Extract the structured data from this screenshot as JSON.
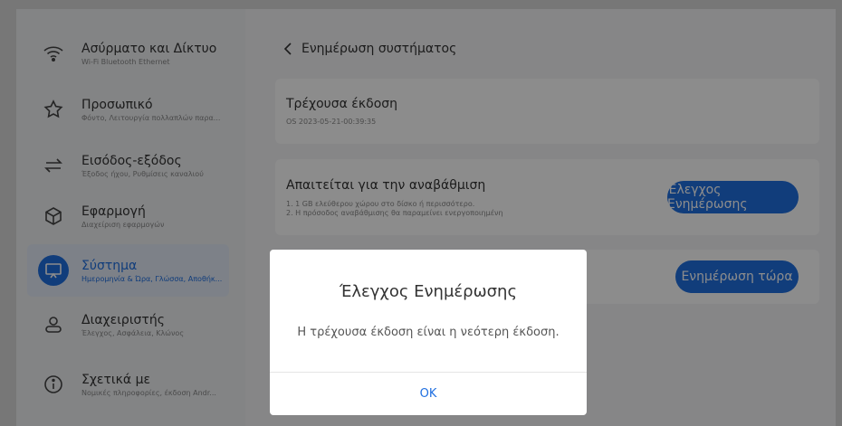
{
  "sidebar": {
    "items": [
      {
        "title": "Ασύρματο και Δίκτυο",
        "sub": "Wi-Fi Bluetooth Ethernet",
        "icon": "wifi-icon"
      },
      {
        "title": "Προσωπικό",
        "sub": "Φόντο, Λειτουργία πολλαπλών παρα...",
        "icon": "star-icon"
      },
      {
        "title": "Εισόδος-εξόδος",
        "sub": "Έξοδος ήχου, Ρυθμίσεις καναλιού",
        "icon": "arrows-swap-icon"
      },
      {
        "title": "Εφαρμογή",
        "sub": "Διαχείριση εφαρμογών",
        "icon": "cube-icon"
      },
      {
        "title": "Σύστημα",
        "sub": "Ημερομηνία & Ώρα, Γλώσσα, Αποθήκ...",
        "icon": "monitor-icon"
      },
      {
        "title": "Διαχειριστής",
        "sub": "Έλεγχος, Ασφάλεια, Κλώνος",
        "icon": "user-icon"
      },
      {
        "title": "Σχετικά με",
        "sub": "Νομικές πληροφορίες, έκδοση Andr...",
        "icon": "info-icon"
      }
    ]
  },
  "main": {
    "back_label": "Ενημέρωση συστήματος",
    "version_card": {
      "title": "Τρέχουσα έκδοση",
      "value": "OS 2023-05-21-00:39:35"
    },
    "requirements_card": {
      "title": "Απαιτείται για την αναβάθμιση",
      "line1": "1. 1 GB ελεύθερου χώρου στο δίσκο ή περισσότερο.",
      "line2": "2. Η πρόσοδος αναβάθμισης θα παραμείνει ενεργοποιημένη",
      "button": "Έλεγχος Ενημέρωσης"
    },
    "update_card": {
      "button": "Ενημέρωση τώρα"
    }
  },
  "dialog": {
    "title": "Έλεγχος Ενημέρωσης",
    "message": "Η τρέχουσα έκδοση είναι η νεότερη έκδοση.",
    "ok": "OK"
  },
  "colors": {
    "accent": "#1f6fe0",
    "overlay": "rgba(0,0,0,0.45)"
  }
}
